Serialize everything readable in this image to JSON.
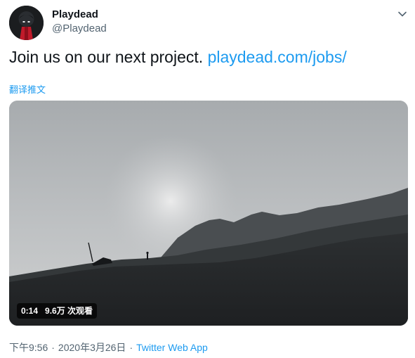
{
  "author": {
    "name": "Playdead",
    "handle": "@Playdead"
  },
  "icons": {
    "avatar": "red-figure-avatar-icon",
    "more": "chevron-down-icon"
  },
  "tweet": {
    "text": "Join us on our next project.",
    "link": "playdead.com/jobs/",
    "translate_label": "翻译推文"
  },
  "media": {
    "duration": "0:14",
    "views": "9.6万 次观看"
  },
  "meta": {
    "time": "下午9:56",
    "date": "2020年3月26日",
    "separator": "·",
    "source": "Twitter Web App"
  },
  "colors": {
    "link": "#1d9bf0",
    "secondary_text": "#536471",
    "primary_text": "#0f1419"
  }
}
